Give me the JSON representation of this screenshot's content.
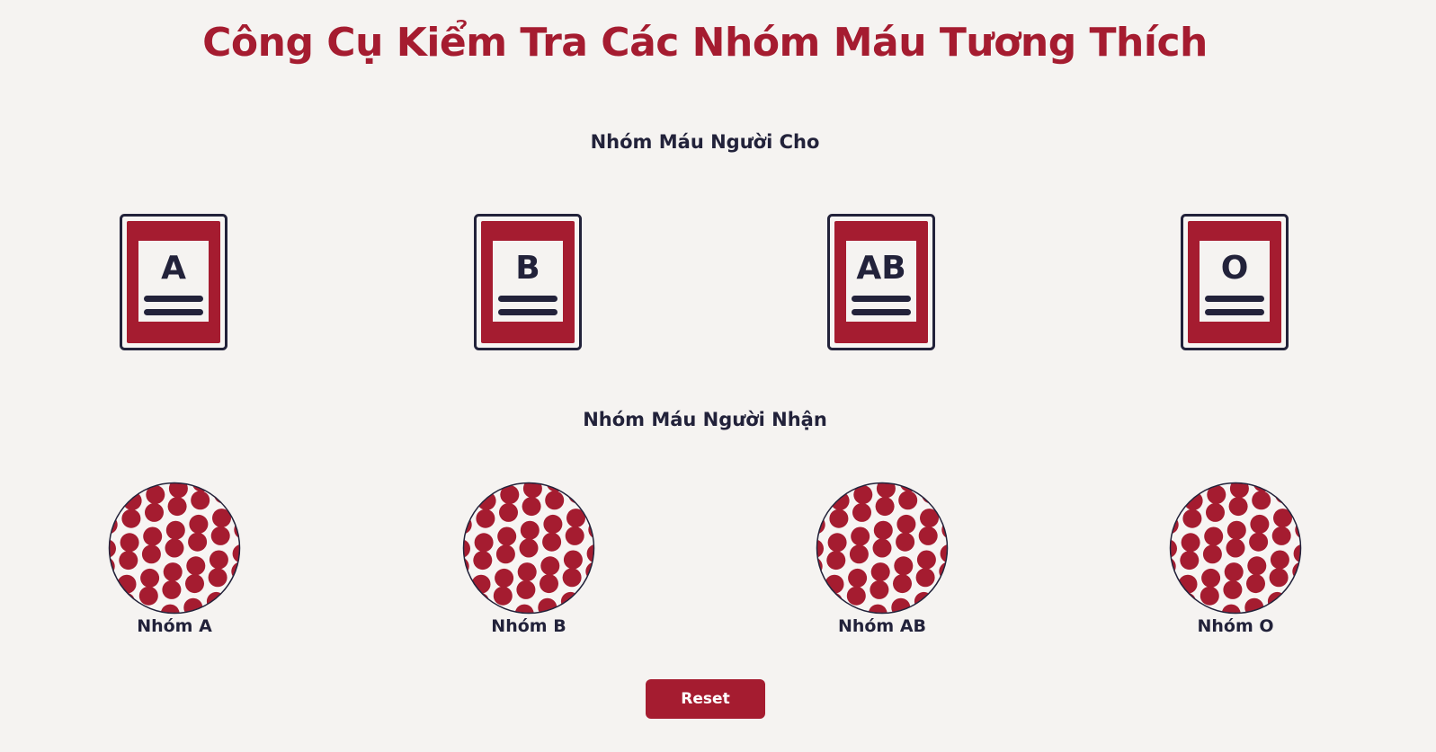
{
  "title": "Công Cụ Kiểm Tra Các Nhóm Máu Tương Thích",
  "donor_section": {
    "label": "Nhóm Máu Người Cho",
    "bags": [
      {
        "type": "A"
      },
      {
        "type": "B"
      },
      {
        "type": "AB"
      },
      {
        "type": "O"
      }
    ]
  },
  "recipient_section": {
    "label": "Nhóm Máu Người Nhận",
    "cells": [
      {
        "label": "Nhóm A"
      },
      {
        "label": "Nhóm B"
      },
      {
        "label": "Nhóm AB"
      },
      {
        "label": "Nhóm O"
      }
    ]
  },
  "reset_button": {
    "label": "Reset"
  },
  "colors": {
    "accent": "#a51c30",
    "background": "#f5f3f1",
    "text": "#22223a"
  },
  "icons": {
    "bag": "blood-bag-icon",
    "cell": "blood-cells-icon"
  }
}
